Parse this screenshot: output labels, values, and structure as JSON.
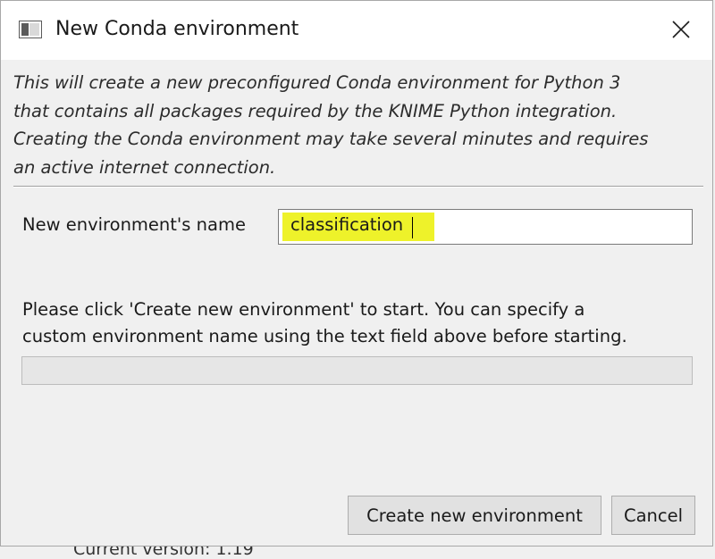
{
  "window": {
    "title": "New Conda environment",
    "icon": "window-icon",
    "close_icon": "close-icon"
  },
  "description": "This will create a new preconfigured Conda environment for Python 3\nthat contains all packages required by the KNIME Python integration.\nCreating the Conda environment may take several minutes and requires\nan active internet connection.",
  "form": {
    "name_label": "New environment's name",
    "name_value": "classification",
    "highlight_color": "#eef22a"
  },
  "status": {
    "message": "Please click 'Create new environment' to start. You can specify a\ncustom environment name using the text field above before starting.",
    "progress": 0
  },
  "buttons": {
    "create_label": "Create new environment",
    "cancel_label": "Cancel"
  },
  "backdrop": {
    "partial_text": "Current version: 1.19"
  }
}
